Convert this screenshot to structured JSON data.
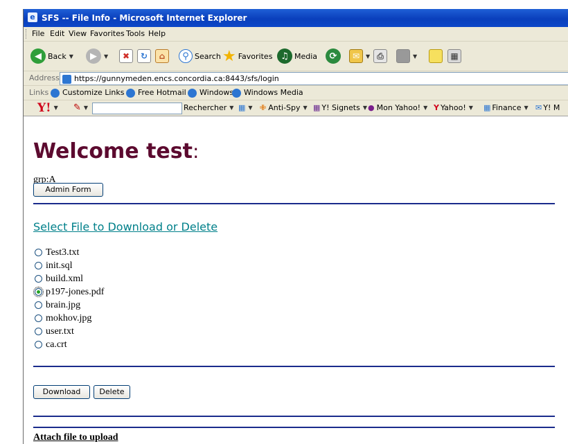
{
  "window": {
    "title": "SFS -- File Info - Microsoft Internet Explorer"
  },
  "menu": [
    "File",
    "Edit",
    "View",
    "Favorites",
    "Tools",
    "Help"
  ],
  "toolbar": {
    "back_label": "Back",
    "search_label": "Search",
    "favorites_label": "Favorites",
    "media_label": "Media"
  },
  "address": {
    "label": "Address",
    "url": "https://gunnymeden.encs.concordia.ca:8443/sfs/login"
  },
  "links": {
    "label": "Links",
    "items": [
      "Customize Links",
      "Free Hotmail",
      "Windows",
      "Windows Media"
    ]
  },
  "yahoo_bar": {
    "logo": "Y!",
    "search_button": "Rechercher",
    "antispy": "Anti-Spy",
    "signets": "Y! Signets",
    "mon_yahoo": "Mon Yahoo!",
    "yahoo": "Yahoo!",
    "finance": "Finance",
    "ymail": "Y! M"
  },
  "page": {
    "welcome": "Welcome test",
    "welcome_suffix": ":",
    "group": "grp:A",
    "admin_button": "Admin Form",
    "select_link": "Select File to Download or Delete",
    "files": [
      {
        "name": "Test3.txt",
        "selected": false
      },
      {
        "name": "init.sql",
        "selected": false
      },
      {
        "name": "build.xml",
        "selected": false
      },
      {
        "name": "p197-jones.pdf",
        "selected": true
      },
      {
        "name": "brain.jpg",
        "selected": false
      },
      {
        "name": "mokhov.jpg",
        "selected": false
      },
      {
        "name": "user.txt",
        "selected": false
      },
      {
        "name": "ca.crt",
        "selected": false
      }
    ],
    "download_button": "Download",
    "delete_button": "Delete",
    "attach_heading": "Attach file to upload"
  }
}
